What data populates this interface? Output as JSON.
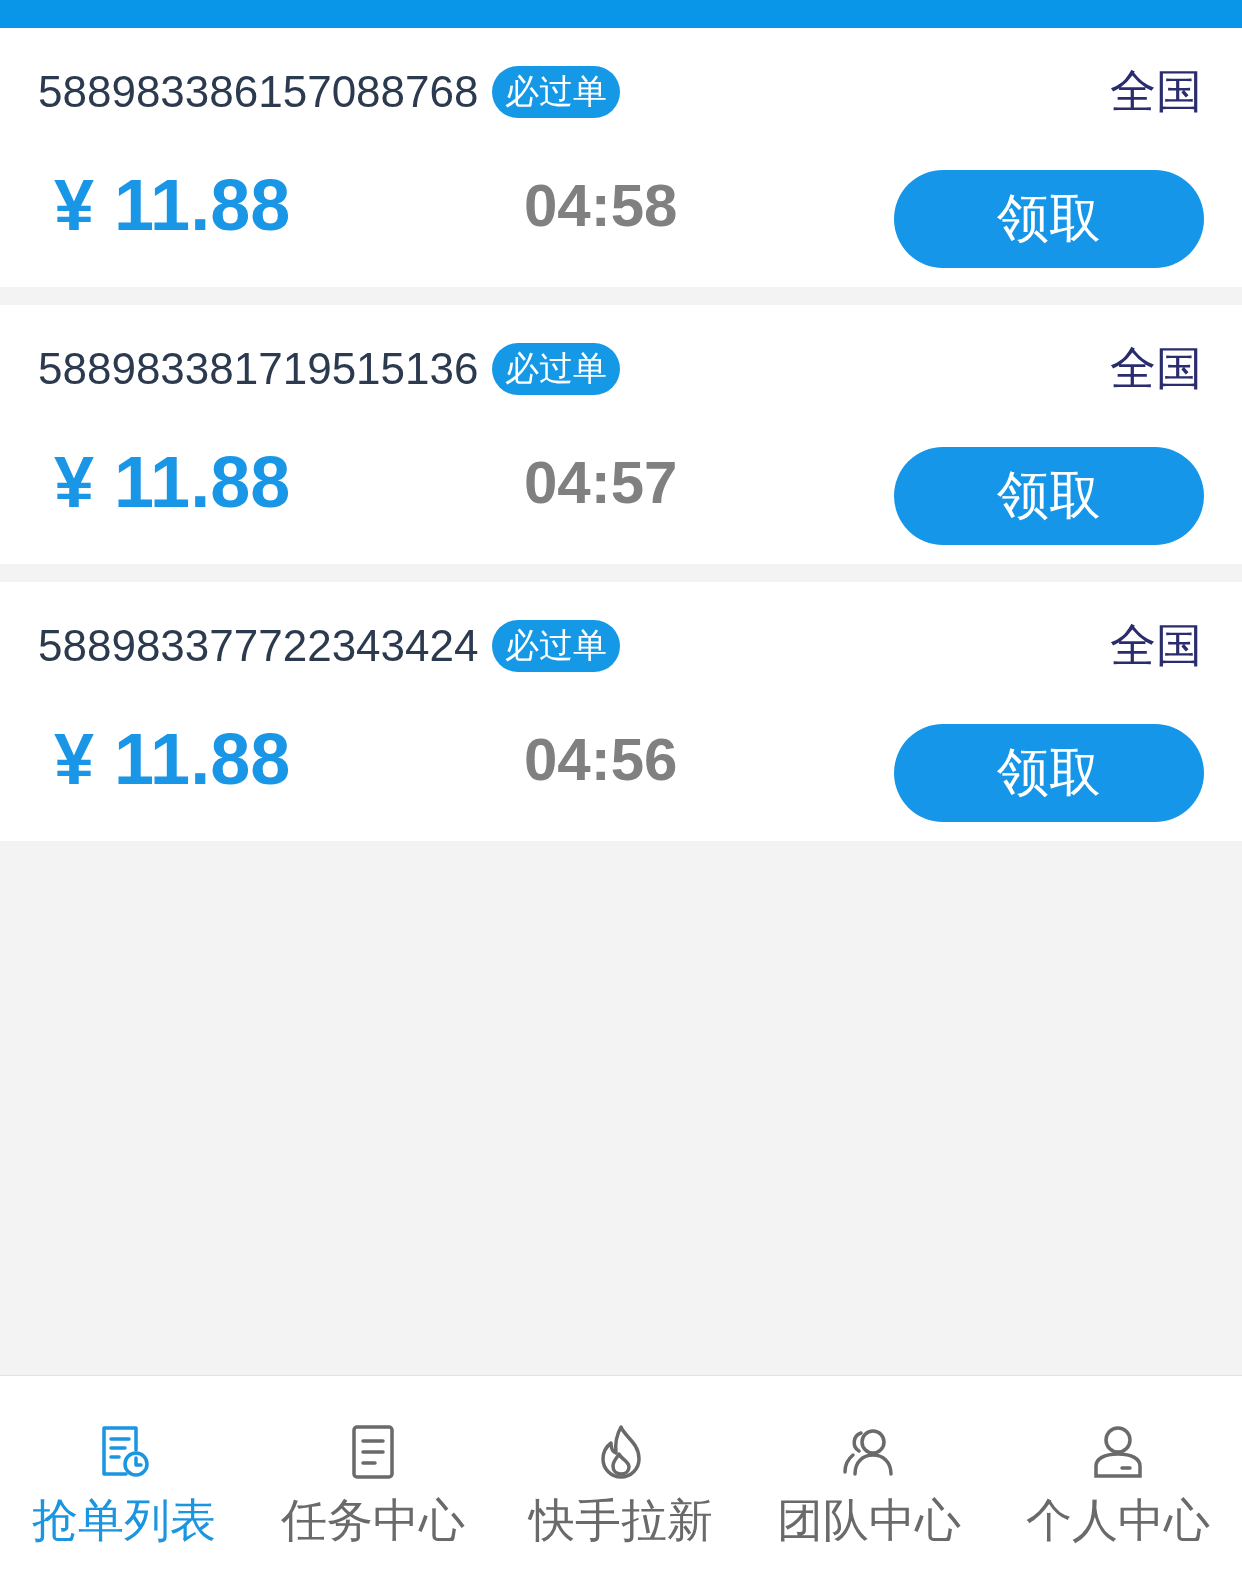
{
  "orders": [
    {
      "id": "588983386157088768",
      "badge": "必过单",
      "region": "全国",
      "price": "¥ 11.88",
      "countdown": "04:58",
      "button": "领取"
    },
    {
      "id": "588983381719515136",
      "badge": "必过单",
      "region": "全国",
      "price": "¥ 11.88",
      "countdown": "04:57",
      "button": "领取"
    },
    {
      "id": "588983377722343424",
      "badge": "必过单",
      "region": "全国",
      "price": "¥ 11.88",
      "countdown": "04:56",
      "button": "领取"
    }
  ],
  "tab_bar": [
    {
      "label": "抢单列表",
      "kind": "list-clock",
      "selected": true
    },
    {
      "label": "任务中心",
      "kind": "document",
      "selected": false
    },
    {
      "label": "快手拉新",
      "kind": "flame",
      "selected": false
    },
    {
      "label": "团队中心",
      "kind": "people",
      "selected": false
    },
    {
      "label": "个人中心",
      "kind": "person",
      "selected": false
    }
  ]
}
